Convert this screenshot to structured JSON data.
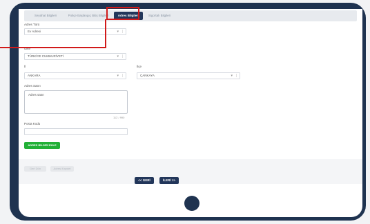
{
  "tabs": [
    {
      "label": "Seyahat Bilgileri",
      "active": false
    },
    {
      "label": "Poliçe Başlangıç Bitiş Bilgileri",
      "active": false
    },
    {
      "label": "Adres Bilgileri",
      "active": true
    },
    {
      "label": "Sigortalı Bilgileri",
      "active": false
    }
  ],
  "form": {
    "address_type": {
      "label": "Adres Türü",
      "value": "Ev Adresi",
      "caret": "▾",
      "sep": "|"
    },
    "country": {
      "label": "Ülke",
      "value": "TÜRKİYE CUMHURİYETİ",
      "caret": "▾",
      "sep": "|"
    },
    "city": {
      "label": "İl",
      "value": "ANKARA",
      "caret": "▾",
      "sep": "|"
    },
    "district": {
      "label": "İlçe",
      "value": "ÇANKAYA",
      "caret": "▾",
      "sep": "|"
    },
    "address_line": {
      "label": "Adres Satırı",
      "value": "Adres satırı",
      "counter": "112 / 990"
    },
    "postal_code": {
      "label": "Posta Kodu",
      "value": ""
    },
    "add_address_button": "ADRES BİLGİSİ EKLE"
  },
  "footer": {
    "ghost_buttons": [
      "Geri Dön",
      "Adresi Kaydet"
    ],
    "back_button": "<< GERİ",
    "next_button": "İLERİ >>"
  }
}
